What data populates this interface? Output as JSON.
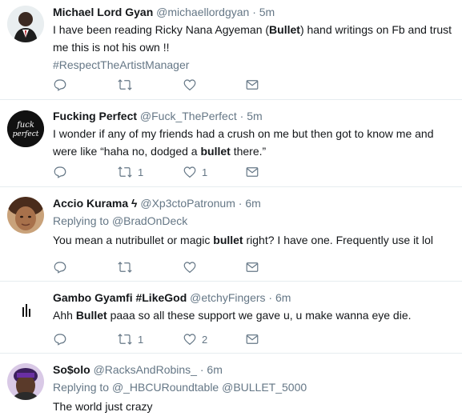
{
  "tweets": [
    {
      "name": "Michael Lord Gyan",
      "handle": "@michaellordgyan",
      "dot": "·",
      "time": "5m",
      "text_parts": [
        "I have been reading Ricky Nana Agyeman (",
        "Bullet",
        ") hand writings on Fb and trust me this is not his own !!"
      ],
      "hashtag": "#RespectTheArtistManager",
      "retweets": "",
      "likes": ""
    },
    {
      "name": "Fucking Perfect",
      "handle": "@Fuck_ThePerfect",
      "dot": "·",
      "time": "5m",
      "avatar_text": "fuck perfect",
      "text_parts": [
        "I wonder if any of my friends had a crush on me but then got to know me and were like “haha no, dodged a ",
        "bullet",
        " there.”"
      ],
      "retweets": "1",
      "likes": "1"
    },
    {
      "name": "Accio Kurama",
      "name_symbol": "ϟ",
      "handle": "@Xp3ctoPatronum",
      "dot": "·",
      "time": "6m",
      "replying_label": "Replying to",
      "replying_to": "@BradOnDeck",
      "text_parts": [
        "You mean a nutribullet or magic ",
        "bullet",
        " right? I have one. Frequently use it lol"
      ],
      "retweets": "",
      "likes": ""
    },
    {
      "name": "Gambo Gyamfi #LikeGod",
      "handle": "@etchyFingers",
      "dot": "·",
      "time": "6m",
      "text_parts": [
        "Ahh ",
        "Bullet",
        " paaa so all these support we gave u, u make wanna eye die."
      ],
      "retweets": "1",
      "likes": "2"
    },
    {
      "name": "So$olo",
      "handle": "@RacksAndRobins_",
      "dot": "·",
      "time": "6m",
      "replying_label": "Replying to",
      "replying_to": "@_HBCURoundtable @BULLET_5000",
      "text_parts": [
        "The world just crazy"
      ]
    }
  ],
  "colors": {
    "text": "#14171a",
    "muted": "#657786",
    "divider": "#e6ecf0"
  },
  "icons": [
    "reply-icon",
    "retweet-icon",
    "like-icon",
    "message-icon"
  ]
}
